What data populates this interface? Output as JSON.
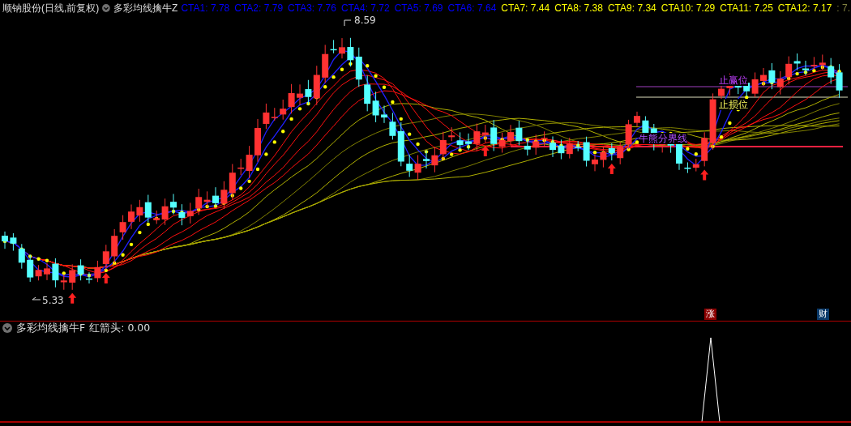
{
  "header": {
    "title": "顺钠股份(日线,前复权)",
    "indicator": "多彩均线擒牛Z",
    "values": [
      {
        "text": "CTA1: 7.78",
        "color": "#0000ff"
      },
      {
        "text": "CTA2: 7.79",
        "color": "#0000ff"
      },
      {
        "text": "CTA3: 7.76",
        "color": "#0000ff"
      },
      {
        "text": "CTA4: 7.72",
        "color": "#0000ff"
      },
      {
        "text": "CTA5: 7.69",
        "color": "#0000ff"
      },
      {
        "text": "CTA6: 7.64",
        "color": "#0000ff"
      },
      {
        "text": "CTA7: 7.44",
        "color": "#ffff00"
      },
      {
        "text": "CTA8: 7.38",
        "color": "#ffff00"
      },
      {
        "text": "CTA9: 7.34",
        "color": "#ffff00"
      },
      {
        "text": "CTA10: 7.29",
        "color": "#ffff00"
      },
      {
        "text": "CTA11: 7.25",
        "color": "#ffff00"
      },
      {
        "text": "CTA12: 7.17",
        "color": "#ffff00"
      },
      {
        "text": ": 7.",
        "color": "#808040"
      }
    ]
  },
  "chart": {
    "high_label": "8.59",
    "low_label": "5.33",
    "stop_profit_label": "止赢位",
    "stop_loss_label": "止损位",
    "trend_line_label": "牛熊分界线",
    "badges": [
      {
        "text": "涨",
        "color": "#8b0000"
      },
      {
        "text": "财",
        "color": "#0a3a6a"
      }
    ]
  },
  "lower": {
    "indicator": "多彩均线擒牛F",
    "reading": "红箭头: 0.00"
  }
}
